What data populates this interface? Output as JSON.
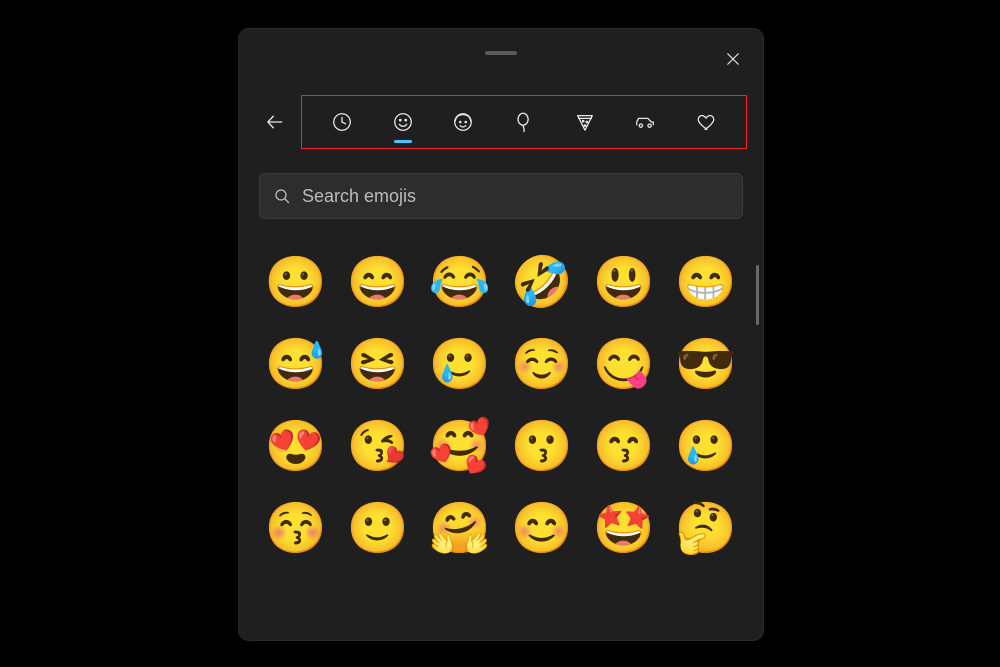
{
  "panel": {
    "close_name": "close",
    "back_name": "back"
  },
  "search": {
    "placeholder": "Search emojis",
    "value": ""
  },
  "categories": [
    {
      "id": "recent",
      "name": "recent-icon",
      "active": false
    },
    {
      "id": "smileys",
      "name": "smiley-face-icon",
      "active": true
    },
    {
      "id": "people",
      "name": "people-icon",
      "active": false
    },
    {
      "id": "events",
      "name": "balloon-icon",
      "active": false
    },
    {
      "id": "food",
      "name": "pizza-icon",
      "active": false
    },
    {
      "id": "travel",
      "name": "car-icon",
      "active": false
    },
    {
      "id": "symbols",
      "name": "heart-icon",
      "active": false
    }
  ],
  "emojis": [
    {
      "char": "😀",
      "name": "grinning-face"
    },
    {
      "char": "😄",
      "name": "grinning-smiling-eyes"
    },
    {
      "char": "😂",
      "name": "face-tears-of-joy"
    },
    {
      "char": "🤣",
      "name": "rolling-on-floor-laughing"
    },
    {
      "char": "😃",
      "name": "grinning-big-eyes"
    },
    {
      "char": "😁",
      "name": "beaming-face"
    },
    {
      "char": "😅",
      "name": "grinning-sweat"
    },
    {
      "char": "😆",
      "name": "grinning-squinting"
    },
    {
      "char": "🥲",
      "name": "smiling-tear"
    },
    {
      "char": "☺️",
      "name": "smiling-face"
    },
    {
      "char": "😋",
      "name": "face-savoring-food"
    },
    {
      "char": "😎",
      "name": "smiling-sunglasses"
    },
    {
      "char": "😍",
      "name": "heart-eyes"
    },
    {
      "char": "😘",
      "name": "face-blowing-kiss"
    },
    {
      "char": "🥰",
      "name": "smiling-hearts"
    },
    {
      "char": "😗",
      "name": "kissing-face"
    },
    {
      "char": "😙",
      "name": "kissing-smiling-eyes"
    },
    {
      "char": "🥲",
      "name": "smiling-tear-2"
    },
    {
      "char": "😚",
      "name": "kissing-closed-eyes"
    },
    {
      "char": "🙂",
      "name": "slightly-smiling"
    },
    {
      "char": "🤗",
      "name": "hugging-face"
    },
    {
      "char": "😊",
      "name": "smiling-smiling-eyes"
    },
    {
      "char": "🤩",
      "name": "star-struck"
    },
    {
      "char": "🤔",
      "name": "thinking-face"
    }
  ],
  "colors": {
    "panel_bg": "#1f1f1f",
    "accent": "#4cc2ff",
    "highlight_box": "#ff2020"
  }
}
